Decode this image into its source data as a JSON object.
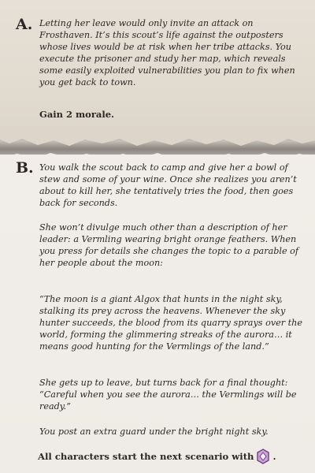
{
  "section_a": {
    "letter": "A.",
    "text": "Letting her leave would only invite an attack on Frosthaven. It’s this scout’s life against the outposters whose lives would be at risk when her tribe attacks. You execute the prisoner and study her map, which reveals some easily exploited vulnerabilities you plan to fix when you get back to town.",
    "reward": "Gain 2 morale."
  },
  "section_b": {
    "letter": "B.",
    "p1": "You walk the scout back to camp and give her a bowl of stew and some of your wine. Once she realizes you aren’t about to kill her, she tentatively tries the food, then goes back for seconds.",
    "p2": "She won’t divulge much other than a description of her leader: a Vermling wearing bright orange feathers. When you press for details she changes the topic to a parable of her people about the moon:",
    "p3": "“The moon is a giant Algox that hunts in the night sky, stalking its prey across the heavens. Whenever the sky hunter succeeds, the blood from its quarry sprays over the world, forming the glimmering streaks of the aurora… it means good hunting for the Vermlings of the land.”",
    "p4": "She gets up to leave, but turns back for a final thought: “Careful when you see the aurora… the Vermlings will be ready.”",
    "p5": "You post an extra guard under the bright night sky.",
    "reward_text": "All characters start the next scenario with",
    "reward_end": ".",
    "reward_icon": "bless-icon"
  },
  "colors": {
    "background_a": "#e2dbd0",
    "background_b": "#efebe6",
    "icon_fill": "#c9a6d6",
    "icon_stroke": "#6f3f83"
  }
}
